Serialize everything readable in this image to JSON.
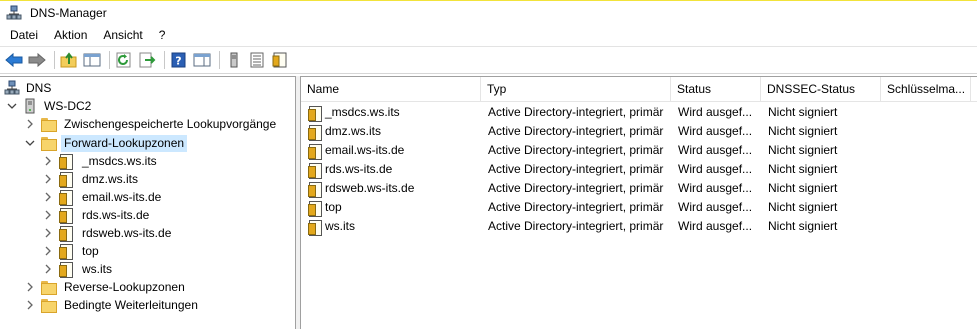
{
  "window": {
    "title": "DNS-Manager",
    "app_icon": "dns-manager-icon"
  },
  "menu": [
    "Datei",
    "Aktion",
    "Ansicht",
    "?"
  ],
  "toolbar": {
    "icons": [
      "back-arrow-icon",
      "forward-arrow-icon",
      "up-folder-icon",
      "show-hide-console-tree-icon",
      "refresh-icon",
      "export-list-icon",
      "help-icon",
      "properties-pane-icon",
      "server-icon",
      "list-view-icon",
      "zone-view-icon"
    ]
  },
  "tree": {
    "root": {
      "label": "DNS",
      "icon": "dns-icon"
    },
    "server": {
      "label": "WS-DC2",
      "icon": "server-icon"
    },
    "cached": {
      "label": "Zwischengespeicherte Lookupvorgänge"
    },
    "forward": {
      "label": "Forward-Lookupzonen"
    },
    "zones": [
      "_msdcs.ws.its",
      "dmz.ws.its",
      "email.ws-its.de",
      "rds.ws-its.de",
      "rdsweb.ws-its.de",
      "top",
      "ws.its"
    ],
    "reverse": {
      "label": "Reverse-Lookupzonen"
    },
    "conditional": {
      "label": "Bedingte Weiterleitungen"
    }
  },
  "list": {
    "columns": [
      "Name",
      "Typ",
      "Status",
      "DNSSEC-Status",
      "Schlüsselma..."
    ],
    "rows": [
      {
        "name": "_msdcs.ws.its",
        "type": "Active Directory-integriert, primär",
        "status": "Wird ausgef...",
        "dnssec": "Nicht signiert",
        "key": ""
      },
      {
        "name": "dmz.ws.its",
        "type": "Active Directory-integriert, primär",
        "status": "Wird ausgef...",
        "dnssec": "Nicht signiert",
        "key": ""
      },
      {
        "name": "email.ws-its.de",
        "type": "Active Directory-integriert, primär",
        "status": "Wird ausgef...",
        "dnssec": "Nicht signiert",
        "key": ""
      },
      {
        "name": "rds.ws-its.de",
        "type": "Active Directory-integriert, primär",
        "status": "Wird ausgef...",
        "dnssec": "Nicht signiert",
        "key": ""
      },
      {
        "name": "rdsweb.ws-its.de",
        "type": "Active Directory-integriert, primär",
        "status": "Wird ausgef...",
        "dnssec": "Nicht signiert",
        "key": ""
      },
      {
        "name": "top",
        "type": "Active Directory-integriert, primär",
        "status": "Wird ausgef...",
        "dnssec": "Nicht signiert",
        "key": ""
      },
      {
        "name": "ws.its",
        "type": "Active Directory-integriert, primär",
        "status": "Wird ausgef...",
        "dnssec": "Nicht signiert",
        "key": ""
      }
    ]
  },
  "colors": {
    "selection": "#cce8ff",
    "titlebar_accent": "#f2e33a"
  }
}
